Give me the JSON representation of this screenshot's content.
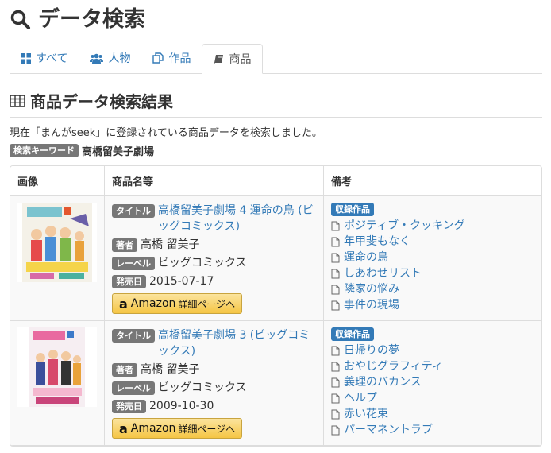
{
  "page": {
    "title": "データ検索"
  },
  "tabs": [
    {
      "label": "すべて",
      "icon": "grid-icon"
    },
    {
      "label": "人物",
      "icon": "users-icon"
    },
    {
      "label": "作品",
      "icon": "copy-icon"
    },
    {
      "label": "商品",
      "icon": "book-icon",
      "active": true
    }
  ],
  "section": {
    "title": "商品データ検索結果"
  },
  "description": "現在「まんがseek」に登録されている商品データを検索しました。",
  "keyword": {
    "label": "検索キーワード",
    "value": "高橋留美子劇場"
  },
  "table": {
    "headers": [
      "画像",
      "商品名等",
      "備考"
    ],
    "rows": [
      {
        "title_label": "タイトル",
        "title": "高橋留美子劇場 4 運命の鳥 (ビッグコミックス)",
        "author_label": "著者",
        "author": "高橋 留美子",
        "label_label": "レーベル",
        "label": "ビッグコミックス",
        "date_label": "発売日",
        "date": "2015-07-17",
        "amazon_main": "Amazon",
        "amazon_sub": "詳細ページへ",
        "works_label": "収録作品",
        "works": [
          "ポジティブ・クッキング",
          "年甲斐もなく",
          "運命の鳥",
          "しあわせリスト",
          "隣家の悩み",
          "事件の現場"
        ]
      },
      {
        "title_label": "タイトル",
        "title": "高橋留美子劇場 3 (ビッグコミックス)",
        "author_label": "著者",
        "author": "高橋 留美子",
        "label_label": "レーベル",
        "label": "ビッグコミックス",
        "date_label": "発売日",
        "date": "2009-10-30",
        "amazon_main": "Amazon",
        "amazon_sub": "詳細ページへ",
        "works_label": "収録作品",
        "works": [
          "日帰りの夢",
          "おやじグラフィティ",
          "義理のバカンス",
          "ヘルプ",
          "赤い花束",
          "パーマネントラブ"
        ]
      }
    ]
  },
  "colors": {
    "link": "#337ab7",
    "badge_gray": "#777777",
    "badge_blue": "#337ab7",
    "amazon": "#f5c544"
  }
}
